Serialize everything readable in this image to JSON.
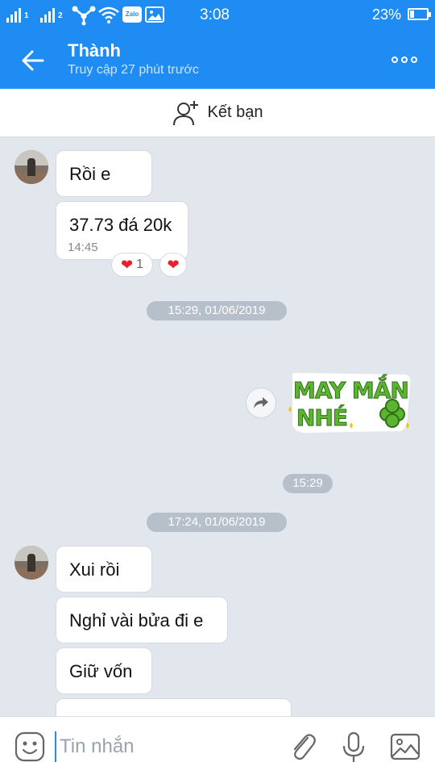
{
  "status_bar": {
    "time": "3:08",
    "battery": "23%",
    "battery_level": 0.23,
    "sim1_label": "1",
    "sim2_label": "2",
    "zalo_badge": "Zalo",
    "icons": [
      "signal-icon",
      "signal-icon",
      "network-icon",
      "wifi-icon",
      "zalo-notification-icon",
      "image-notification-icon",
      "battery-icon"
    ]
  },
  "header": {
    "contact_name": "Thành",
    "contact_status": "Truy cập 27 phút trước",
    "back_icon": "arrow-left-icon",
    "more_icon": "more-horizontal-icon"
  },
  "add_friend": {
    "label": "Kết bạn",
    "icon": "add-person-icon"
  },
  "messages": [
    {
      "sender": "other",
      "text": "Rồi e"
    },
    {
      "sender": "other",
      "text": "37.73 đá 20k",
      "time": "14:45",
      "reactions": [
        {
          "icon": "heart-icon",
          "count": "1"
        },
        {
          "icon": "heart-icon"
        }
      ]
    },
    {
      "type": "time_separator",
      "text": "15:29, 01/06/2019"
    },
    {
      "sender": "me",
      "type": "sticker",
      "sticker_text_line1": "MAY MẮN",
      "sticker_text_line2": "NHÉ",
      "time": "15:29",
      "share_icon": "share-icon"
    },
    {
      "type": "time_separator",
      "text": "17:24, 01/06/2019"
    },
    {
      "sender": "other",
      "text": "Xui rồi"
    },
    {
      "sender": "other",
      "text": "Nghỉ vài bửa đi e"
    },
    {
      "sender": "other",
      "text": "Giữ vốn"
    }
  ],
  "input_bar": {
    "placeholder": "Tin nhắn",
    "icons": [
      "emoji-icon",
      "attach-icon",
      "mic-icon",
      "image-icon"
    ]
  },
  "colors": {
    "accent": "#1e8cf3",
    "background": "#e2e7ee",
    "heart": "#e8202e",
    "sticker_green": "#5cb531"
  }
}
